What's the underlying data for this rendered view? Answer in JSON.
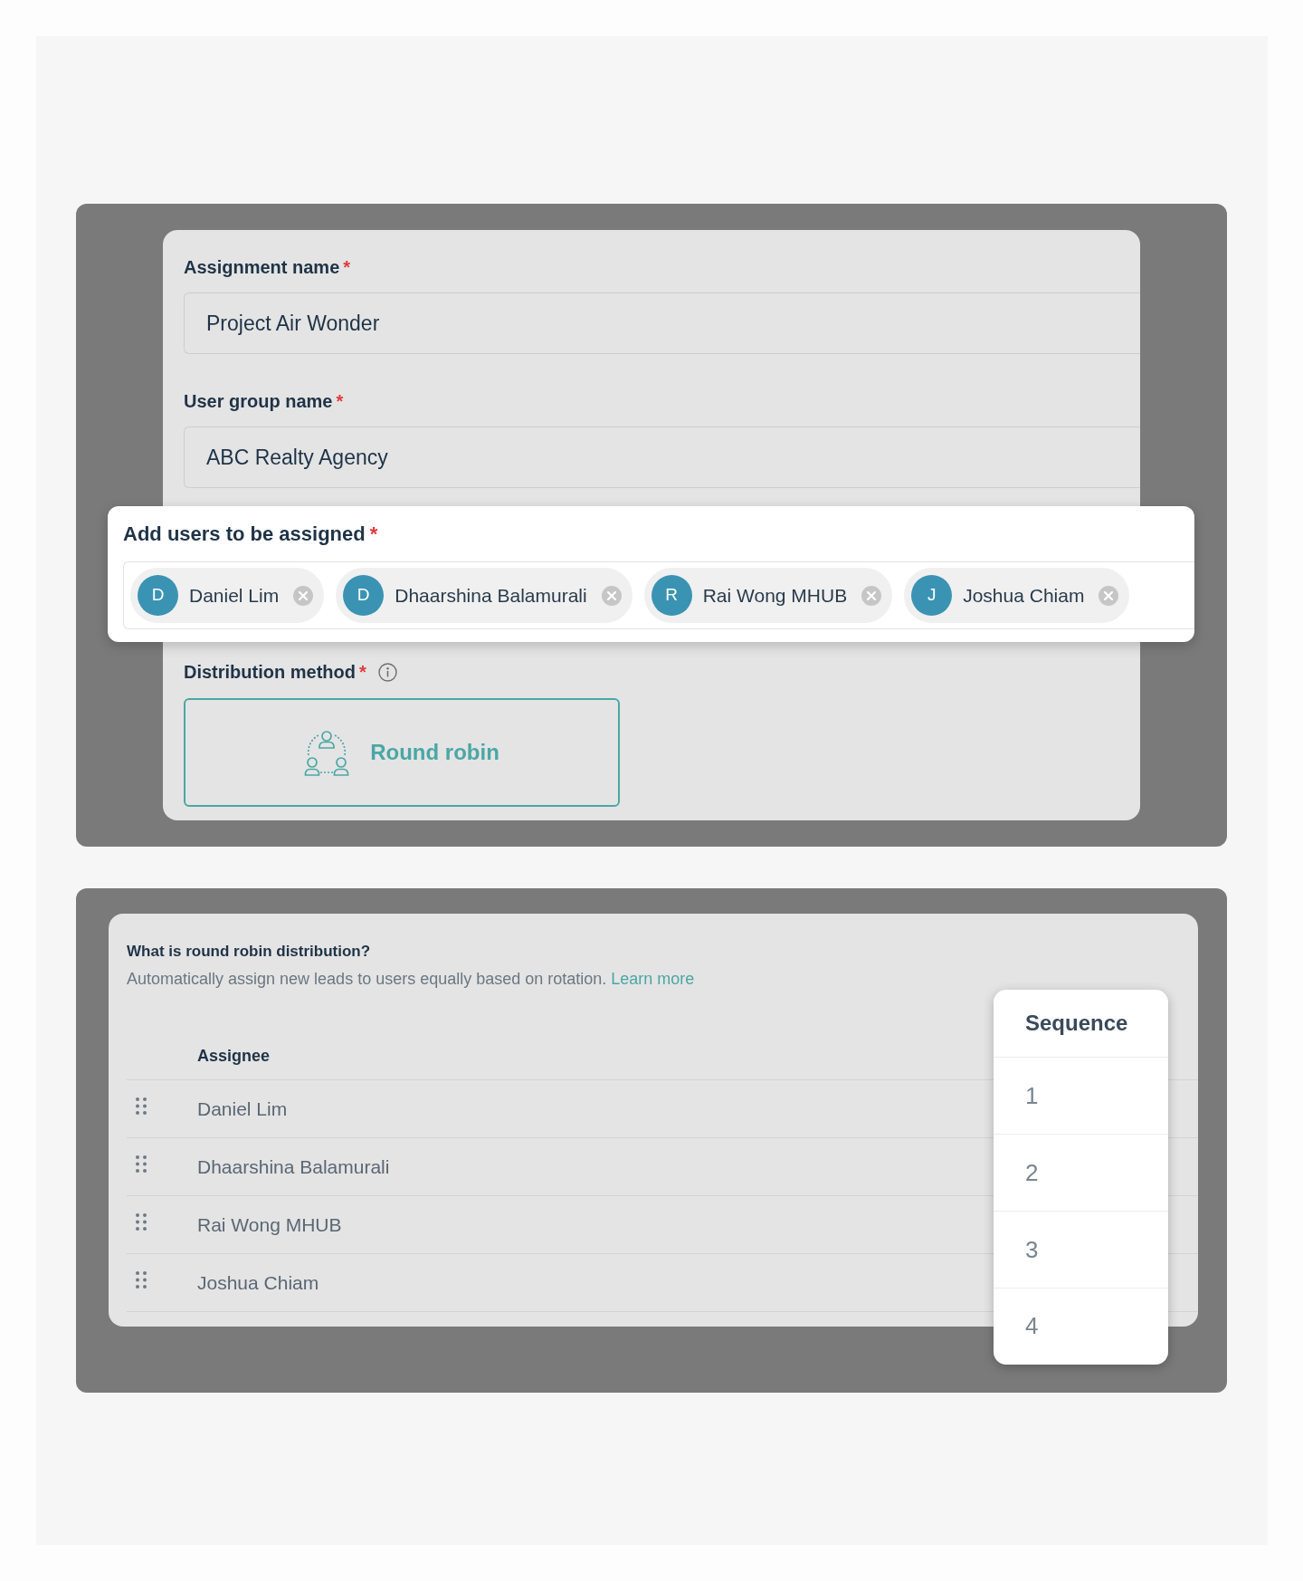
{
  "fields": [
    {
      "label": "Assignment name",
      "required_mark": "*",
      "value": "Project Air Wonder"
    },
    {
      "label": "User group name",
      "required_mark": "*",
      "value": "ABC Realty Agency"
    }
  ],
  "users_field": {
    "label": "Add users to be assigned",
    "required_mark": "*",
    "chips": [
      {
        "initial": "D",
        "name": "Daniel Lim"
      },
      {
        "initial": "D",
        "name": "Dhaarshina Balamurali"
      },
      {
        "initial": "R",
        "name": "Rai Wong MHUB"
      },
      {
        "initial": "J",
        "name": "Joshua Chiam"
      }
    ]
  },
  "distribution": {
    "label": "Distribution method",
    "required_mark": "*",
    "options": [
      {
        "label": "Round robin",
        "selected": true
      }
    ]
  },
  "info": {
    "title": "What is round robin distribution?",
    "description": "Automatically assign new leads to users equally based on rotation.",
    "link": "Learn more"
  },
  "assignee_table": {
    "header": "Assignee",
    "rows": [
      {
        "assignee": "Daniel Lim"
      },
      {
        "assignee": "Dhaarshina Balamurali"
      },
      {
        "assignee": "Rai Wong MHUB"
      },
      {
        "assignee": "Joshua Chiam"
      }
    ]
  },
  "sequence_column": {
    "header": "Sequence",
    "values": [
      "1",
      "2",
      "3",
      "4"
    ]
  }
}
